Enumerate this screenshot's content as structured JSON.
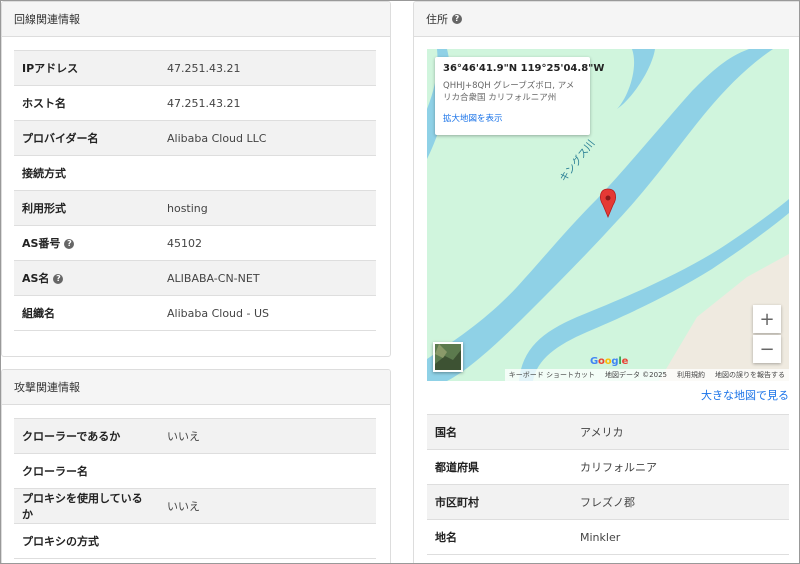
{
  "line_info": {
    "title": "回線関連情報",
    "rows": [
      {
        "label": "IPアドレス",
        "value": "47.251.43.21"
      },
      {
        "label": "ホスト名",
        "value": "47.251.43.21"
      },
      {
        "label": "プロバイダー名",
        "value": "Alibaba Cloud LLC"
      },
      {
        "label": "接続方式",
        "value": ""
      },
      {
        "label": "利用形式",
        "value": "hosting"
      },
      {
        "label": "AS番号",
        "value": "45102"
      },
      {
        "label": "AS名",
        "value": "ALIBABA-CN-NET"
      },
      {
        "label": "組織名",
        "value": "Alibaba Cloud - US"
      }
    ]
  },
  "attack_info": {
    "title": "攻撃関連情報",
    "rows": [
      {
        "label": "クローラーであるか",
        "value": "いいえ"
      },
      {
        "label": "クローラー名",
        "value": ""
      },
      {
        "label": "プロキシを使用しているか",
        "value": "いいえ"
      },
      {
        "label": "プロキシの方式",
        "value": ""
      }
    ]
  },
  "address": {
    "title": "住所",
    "help_icon": "question-circle-icon",
    "map": {
      "coordinates": "36°46'41.9\"N 119°25'04.8\"W",
      "address_line": "QHHJ+8QH グレーブズボロ, アメリカ合衆国 カリフォルニア州",
      "enlarge_link": "拡大地図を表示",
      "river_label": "キングス川",
      "zoom_in": "+",
      "zoom_out": "−",
      "google_logo": "Google",
      "footer": {
        "shortcuts": "キーボード ショートカット",
        "data": "地図データ ©2025",
        "terms": "利用規約",
        "report": "地図の誤りを報告する"
      },
      "colors": {
        "land": "#d0f5dd",
        "river": "#8fd1e6",
        "urban": "#efeae0",
        "marker": "#e53935"
      }
    },
    "larger_map_link": "大きな地図で見る",
    "rows": [
      {
        "label": "国名",
        "value": "アメリカ"
      },
      {
        "label": "都道府県",
        "value": "カリフォルニア"
      },
      {
        "label": "市区町村",
        "value": "フレズノ郡"
      },
      {
        "label": "地名",
        "value": "Minkler"
      }
    ]
  }
}
